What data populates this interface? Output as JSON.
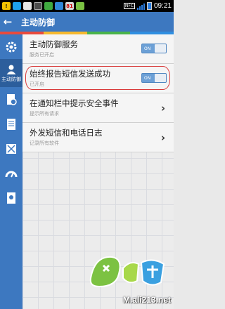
{
  "status_bar": {
    "time": "09:21",
    "nfc": "NFC",
    "icons": [
      "alert-icon",
      "chat-icon",
      "shield-icon",
      "toggle-icon",
      "lock-icon",
      "security-icon",
      "badge-81-icon",
      "android-icon"
    ],
    "badge_text": "81"
  },
  "header": {
    "back": "←",
    "title": "主动防御",
    "bg_color": "#3d78c0",
    "stripe_colors": [
      "#e84a3c",
      "#f5b82e",
      "#49b34a",
      "#2f8fe0"
    ]
  },
  "sidebar": {
    "active_label": "主动防御",
    "items": [
      "settings-icon",
      "shield-user-icon",
      "file-shield-icon",
      "document-icon",
      "grid-icon",
      "speedometer-icon",
      "report-icon"
    ]
  },
  "settings": {
    "items": [
      {
        "title": "主动防御服务",
        "subtitle": "服务已开启",
        "control": "toggle",
        "toggle_label": "ON"
      },
      {
        "title": "始终报告短信发送成功",
        "subtitle": "已开启",
        "control": "toggle",
        "toggle_label": "ON"
      },
      {
        "title": "在通知栏中提示安全事件",
        "subtitle": "提示所有请求",
        "control": "chevron",
        "chevron": "›"
      },
      {
        "title": "外发短信和电话日志",
        "subtitle": "记录所有软件",
        "control": "chevron",
        "chevron": "›"
      }
    ]
  },
  "watermark": {
    "url": "M.ali213.net",
    "logo": "game-site-logo"
  }
}
